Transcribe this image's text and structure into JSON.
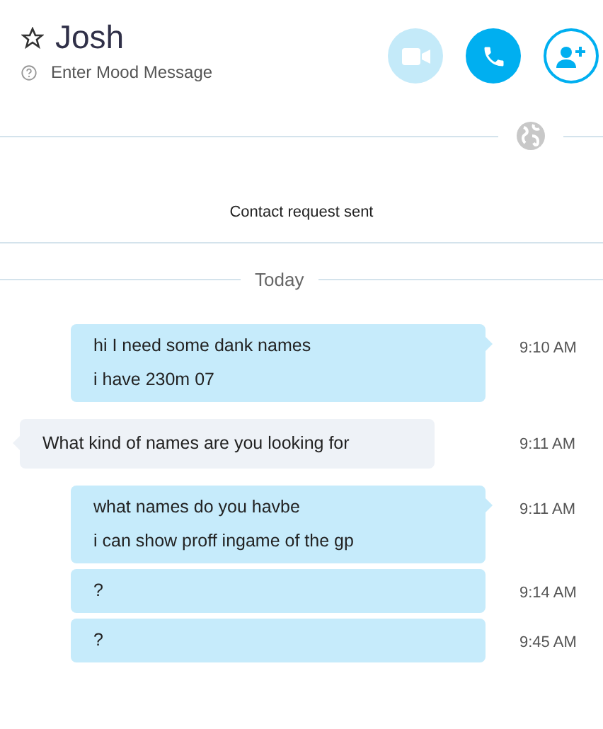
{
  "contact": {
    "name": "Josh",
    "favorite": false,
    "mood_placeholder": "Enter Mood Message"
  },
  "call_buttons": [
    {
      "kind": "video",
      "disabled": true
    },
    {
      "kind": "call",
      "disabled": false
    },
    {
      "kind": "add-contact",
      "disabled": false
    }
  ],
  "notice": "Contact request sent",
  "day_separator": "Today",
  "messages": [
    {
      "kind": "sent",
      "tail": true,
      "lines": [
        "hi I need some dank names",
        "i have 230m 07"
      ],
      "time": "9:10 AM"
    },
    {
      "kind": "received",
      "tail": true,
      "lines": [
        "What kind of names are you looking for"
      ],
      "time": "9:11 AM"
    },
    {
      "kind": "sent",
      "tail": true,
      "lines": [
        "what names do you havbe",
        "i can show proff ingame of the gp"
      ],
      "time": "9:11 AM"
    },
    {
      "kind": "sent",
      "tail": false,
      "lines": [
        "?"
      ],
      "time": "9:14 AM"
    },
    {
      "kind": "sent",
      "tail": false,
      "lines": [
        "?"
      ],
      "time": "9:45 AM"
    }
  ]
}
